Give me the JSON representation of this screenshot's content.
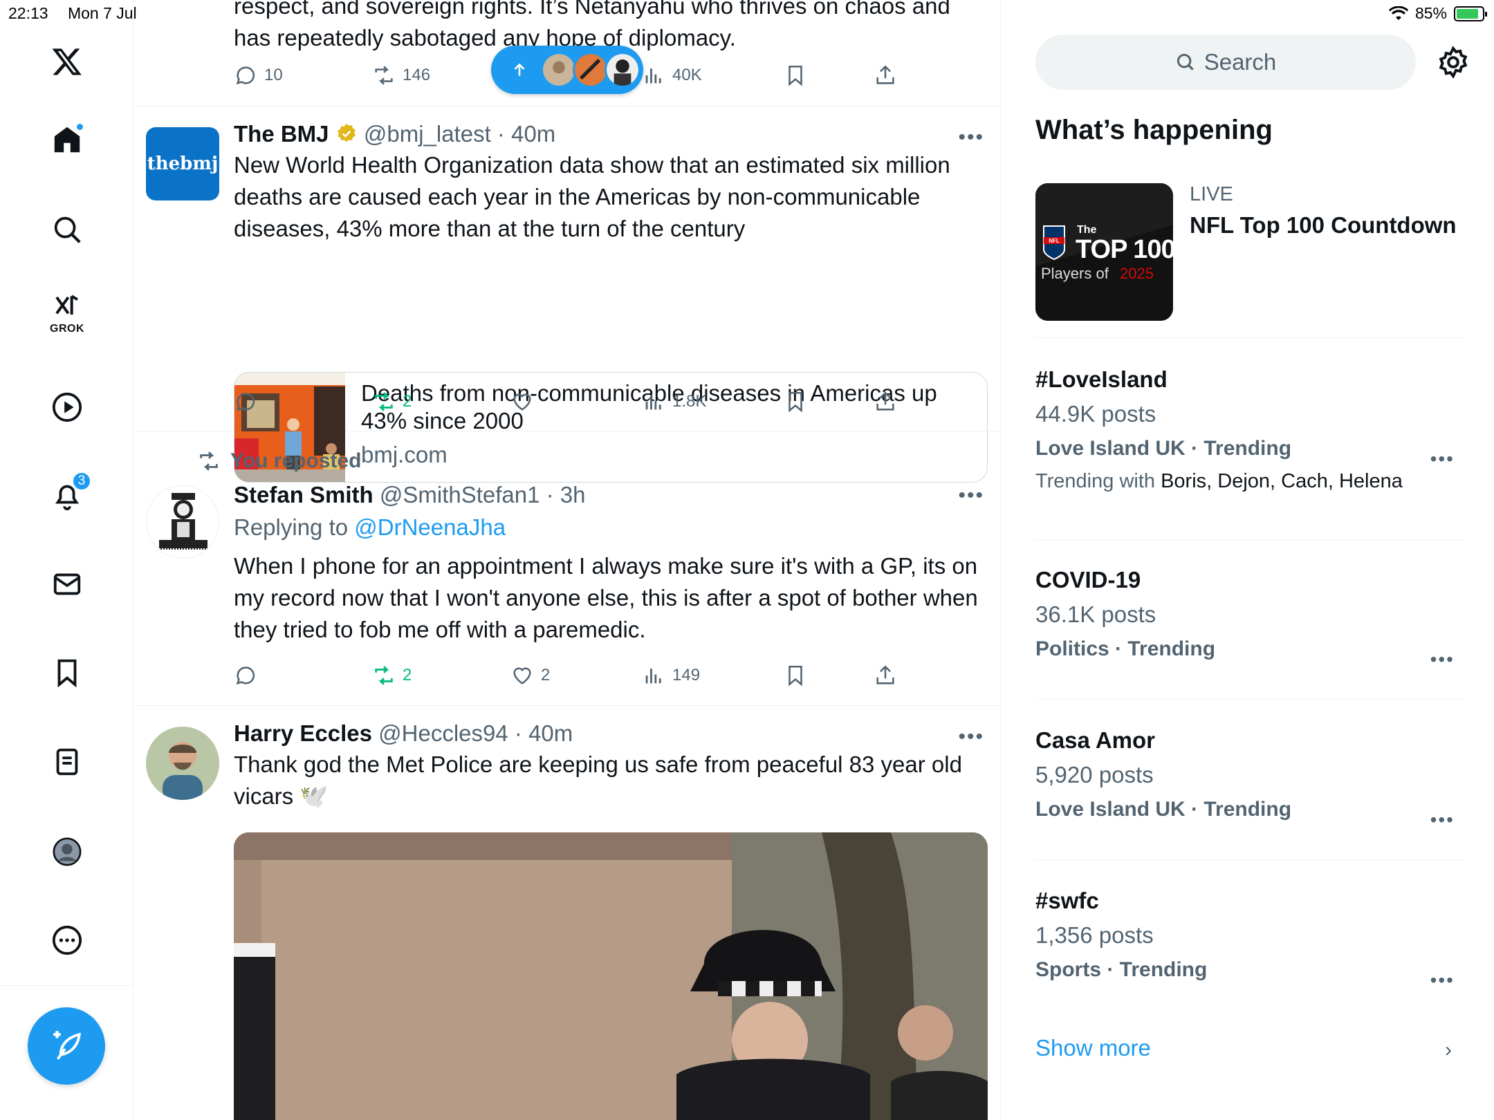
{
  "status_bar": {
    "time": "22:13",
    "date": "Mon 7 Jul",
    "battery": "85%"
  },
  "nav": {
    "notifications_count": "3",
    "grok_label": "GROK"
  },
  "new_posts_pill": {
    "icon": "arrow-up-icon"
  },
  "tweets": [
    {
      "text": "respect, and sovereign rights. It’s Netanyahu who thrives on chaos and has repeatedly sabotaged any hope of diplomacy.",
      "replies": "10",
      "reposts": "146",
      "views": "40K"
    },
    {
      "name": "The BMJ",
      "handle": "@bmj_latest",
      "time": "40m",
      "avatar_text": "thebmj",
      "text": "New World Health Organization data show that an estimated six million deaths are caused each year in the Americas by non-communicable diseases, 43% more than at the turn of the century",
      "link_title": "Deaths from non-communicable diseases in Americas up 43% since 2000",
      "link_domain": "bmj.com",
      "replies": "",
      "reposts": "2",
      "views": "1.8K"
    },
    {
      "repost_label": "You reposted",
      "name": "Stefan Smith",
      "handle": "@SmithStefan1",
      "time": "3h",
      "replying_prefix": "Replying to",
      "replying_to": "@DrNeenaJha",
      "text": "When I phone for an appointment I always make sure it's with a GP, its on my record now that I won't anyone else, this is after a spot of bother when they tried to fob me off with a paremedic.",
      "reposts": "2",
      "likes": "2",
      "views": "149"
    },
    {
      "name": "Harry Eccles",
      "handle": "@Heccles94",
      "time": "40m",
      "text": "Thank god the Met Police are keeping us safe from peaceful 83 year old vicars 🕊️"
    }
  ],
  "right": {
    "search_placeholder": "Search",
    "whats_happening": "What’s happening",
    "live": {
      "tag": "LIVE",
      "title": "NFL Top 100 Countdown",
      "thumb_line1": "The",
      "thumb_line2": "TOP 100",
      "thumb_line3": "Players of",
      "thumb_year": "2025"
    },
    "trends": [
      {
        "name": "#LoveIsland",
        "posts": "44.9K posts",
        "context": "Love Island UK · Trending",
        "with_prefix": "Trending with",
        "with": "Boris, Dejon, Cach, Helena"
      },
      {
        "name": "COVID-19",
        "posts": "36.1K posts",
        "context": "Politics · Trending"
      },
      {
        "name": "Casa Amor",
        "posts": "5,920 posts",
        "context": "Love Island UK · Trending"
      },
      {
        "name": "#swfc",
        "posts": "1,356 posts",
        "context": "Sports · Trending"
      }
    ],
    "show_more": "Show more"
  },
  "colors": {
    "accent": "#1d9bf0",
    "repost_green": "#00ba7c",
    "muted": "#536471",
    "text": "#0f1419"
  }
}
